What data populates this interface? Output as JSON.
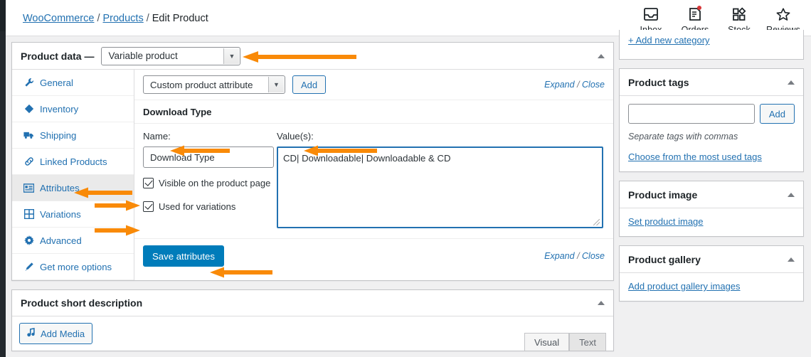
{
  "breadcrumb": {
    "root": "WooCommerce",
    "section": "Products",
    "current": "Edit Product",
    "separator": "/"
  },
  "topnav": {
    "items": [
      {
        "label": "Inbox",
        "icon": "inbox-icon",
        "badge": false
      },
      {
        "label": "Orders",
        "icon": "orders-icon",
        "badge": true
      },
      {
        "label": "Stock",
        "icon": "stock-icon",
        "badge": false
      },
      {
        "label": "Reviews",
        "icon": "reviews-star-icon",
        "badge": false
      }
    ]
  },
  "product_data": {
    "title": "Product data —",
    "type_value": "Variable product",
    "tabs": [
      {
        "label": "General",
        "icon": "wrench-icon",
        "active": false
      },
      {
        "label": "Inventory",
        "icon": "box-icon",
        "active": false
      },
      {
        "label": "Shipping",
        "icon": "truck-icon",
        "active": false
      },
      {
        "label": "Linked Products",
        "icon": "link-icon",
        "active": false
      },
      {
        "label": "Attributes",
        "icon": "list-icon",
        "active": true
      },
      {
        "label": "Variations",
        "icon": "grid-icon",
        "active": false
      },
      {
        "label": "Advanced",
        "icon": "gear-icon",
        "active": false
      },
      {
        "label": "Get more options",
        "icon": "extension-icon",
        "active": false
      }
    ]
  },
  "attributes": {
    "select_value": "Custom product attribute",
    "add_button": "Add",
    "expand_label": "Expand",
    "close_label": "Close",
    "expand_separator": "/",
    "attribute_name_heading": "Download Type",
    "name_label": "Name:",
    "name_value": "Download Type",
    "values_label": "Value(s):",
    "values_value": "CD| Downloadable| Downloadable & CD",
    "checkbox_visible": {
      "label": "Visible on the product page",
      "checked": true
    },
    "checkbox_variations": {
      "label": "Used for variations",
      "checked": true
    },
    "save_button": "Save attributes"
  },
  "short_description": {
    "title": "Product short description",
    "add_media": "Add Media",
    "tabs": [
      {
        "label": "Visual",
        "active": true
      },
      {
        "label": "Text",
        "active": false
      }
    ]
  },
  "sidebar": {
    "categories": {
      "add_new_link": "+ Add new category"
    },
    "tags": {
      "title": "Product tags",
      "add_button": "Add",
      "input_value": "",
      "hint": "Separate tags with commas",
      "most_used_link": "Choose from the most used tags"
    },
    "image": {
      "title": "Product image",
      "set_link": "Set product image"
    },
    "gallery": {
      "title": "Product gallery",
      "add_link": "Add product gallery images"
    }
  },
  "annotations": {
    "color": "#F98A08",
    "arrows": [
      {
        "target": "product-type-select",
        "direction": "left"
      },
      {
        "target": "attributes-tab",
        "direction": "left"
      },
      {
        "target": "name-label",
        "direction": "left"
      },
      {
        "target": "values-label",
        "direction": "left"
      },
      {
        "target": "visible-checkbox",
        "direction": "right"
      },
      {
        "target": "variations-checkbox",
        "direction": "right"
      },
      {
        "target": "save-attributes",
        "direction": "right"
      }
    ]
  },
  "colors": {
    "accent_blue": "#2271b1",
    "primary_button": "#007cba",
    "focus_border": "#2271b1",
    "annotation_orange": "#F98A08"
  }
}
